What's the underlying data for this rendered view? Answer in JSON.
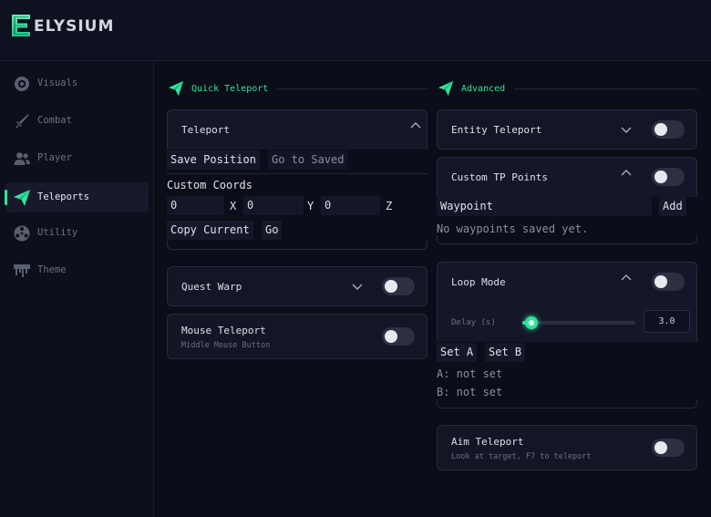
{
  "app": {
    "logo_letter": "E",
    "name": "ELYSIUM",
    "accent": "#2ee59d"
  },
  "sidebar": {
    "items": [
      {
        "label": "Visuals",
        "icon": "eye-target-icon",
        "active": false
      },
      {
        "label": "Combat",
        "icon": "sword-icon",
        "active": false
      },
      {
        "label": "Player",
        "icon": "users-icon",
        "active": false
      },
      {
        "label": "Teleports",
        "icon": "paper-plane-icon",
        "active": true
      },
      {
        "label": "Utility",
        "icon": "gear-icon",
        "active": false
      },
      {
        "label": "Theme",
        "icon": "paint-drip-icon",
        "active": false
      }
    ]
  },
  "quick_teleport": {
    "section_label": "Quick Teleport",
    "teleport": {
      "title": "Teleport",
      "save_position": "Save Position",
      "go_to_saved": "Go to Saved",
      "custom_coords_label": "Custom Coords",
      "x_value": "0",
      "x_label": "X",
      "y_value": "0",
      "y_label": "Y",
      "z_value": "0",
      "z_label": "Z",
      "copy_current": "Copy Current",
      "go": "Go"
    },
    "quest_warp": {
      "title": "Quest Warp",
      "enabled": false
    },
    "mouse_teleport": {
      "title": "Mouse Teleport",
      "subtitle": "Middle Mouse Button",
      "enabled": false
    }
  },
  "advanced": {
    "section_label": "Advanced",
    "entity_teleport": {
      "title": "Entity Teleport",
      "enabled": false
    },
    "custom_tp_points": {
      "title": "Custom TP Points",
      "enabled": false,
      "waypoint_placeholder": "Waypoint",
      "add": "Add",
      "empty_text": "No waypoints saved yet."
    },
    "loop_mode": {
      "title": "Loop Mode",
      "enabled": false,
      "delay_label": "Delay (s)",
      "delay_value": "3.0",
      "delay_fraction": 0.08,
      "set_a": "Set A",
      "set_b": "Set B",
      "a_status": "A: not set",
      "b_status": "B: not set"
    },
    "aim_teleport": {
      "title": "Aim Teleport",
      "subtitle": "Look at target, F7 to teleport",
      "enabled": false
    }
  }
}
